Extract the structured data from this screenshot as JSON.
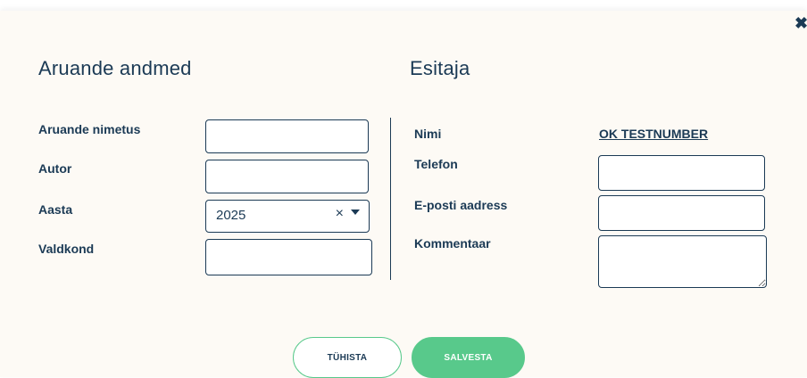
{
  "dialog": {
    "close_icon": "close-icon"
  },
  "report_section": {
    "title": "Aruande andmed",
    "fields": {
      "name_label": "Aruande nimetus",
      "name_value": "",
      "author_label": "Autor",
      "author_value": "",
      "year_label": "Aasta",
      "year_value": "2025",
      "field_label": "Valdkond",
      "field_value": ""
    }
  },
  "submitter_section": {
    "title": "Esitaja",
    "fields": {
      "name_label": "Nimi",
      "name_value": "OK TESTNUMBER",
      "phone_label": "Telefon",
      "phone_value": "",
      "email_label": "E-posti aadress",
      "email_value": "",
      "comment_label": "Kommentaar",
      "comment_value": ""
    }
  },
  "actions": {
    "cancel_label": "TÜHISTA",
    "save_label": "SALVESTA"
  },
  "colors": {
    "primary_text": "#1b3a55",
    "accent_green": "#58c98b",
    "modal_background": "#fdfaf5"
  }
}
